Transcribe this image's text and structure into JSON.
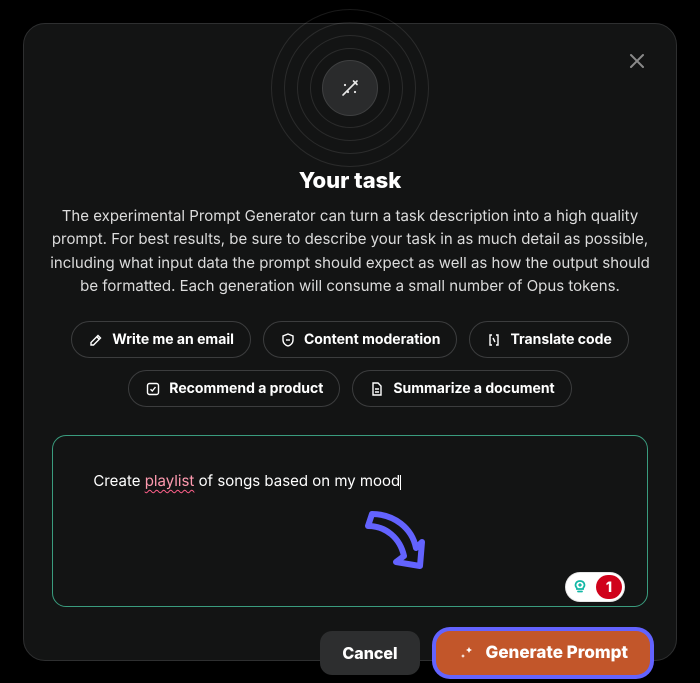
{
  "modal": {
    "title": "Your task",
    "description": "The experimental Prompt Generator can turn a task description into a high quality prompt. For best results, be sure to describe your task in as much detail as possible, including what input data the prompt should expect as well as how the output should be formatted. Each generation will consume a small number of Opus tokens."
  },
  "chips": {
    "email": "Write me an email",
    "moderation": "Content moderation",
    "translate": "Translate code",
    "recommend": "Recommend a product",
    "summarize": "Summarize a document"
  },
  "textarea": {
    "value": "Create playlist of songs based on my mood",
    "prefix": "Create ",
    "misspelled": "playlist",
    "suffix": " of songs based on my mood"
  },
  "badge": {
    "count": "1"
  },
  "actions": {
    "cancel": "Cancel",
    "generate": "Generate Prompt"
  },
  "icons": {
    "wand": "wand-icon",
    "close": "close-icon",
    "pen": "pen-icon",
    "shield": "shield-icon",
    "code": "code-brackets-icon",
    "cart": "checkbox-icon",
    "doc": "document-icon",
    "bulb": "lightbulb-plus-icon",
    "sparkles": "sparkles-icon"
  },
  "colors": {
    "primary": "#c2562a",
    "highlight": "#6363ff",
    "textarea_border": "#3a9c7e",
    "badge_red": "#d0021b",
    "badge_teal": "#13b8a6"
  }
}
